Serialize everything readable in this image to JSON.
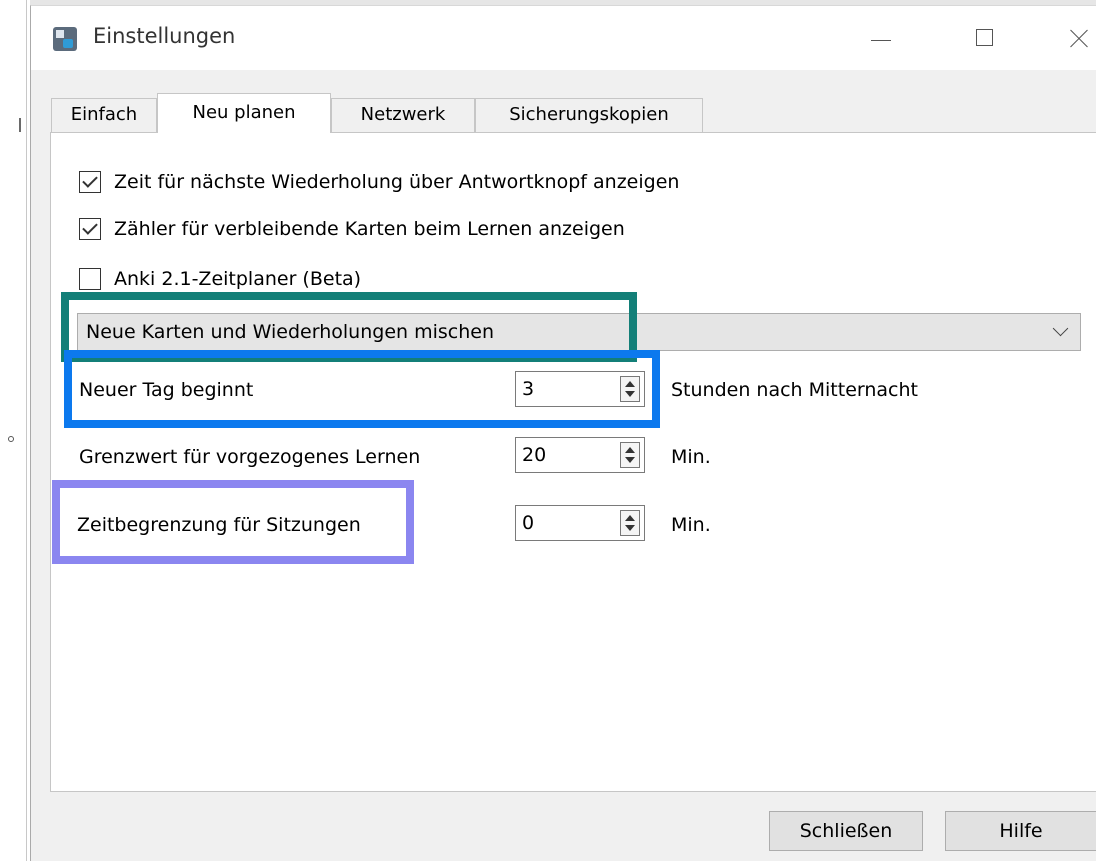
{
  "window": {
    "title": "Einstellungen",
    "icon": "anki-app-icon",
    "controls": [
      "minimize-icon",
      "maximize-icon",
      "close-icon"
    ]
  },
  "tabs": [
    {
      "label": "Einfach",
      "active": false
    },
    {
      "label": "Neu planen",
      "active": true
    },
    {
      "label": "Netzwerk",
      "active": false
    },
    {
      "label": "Sicherungskopien",
      "active": false
    }
  ],
  "options": {
    "show_next_review_time": {
      "label": "Zeit für nächste Wiederholung über Antwortknopf anzeigen",
      "checked": true
    },
    "show_remaining_count": {
      "label": "Zähler für verbleibende Karten beim Lernen anzeigen",
      "checked": true
    },
    "anki21_scheduler": {
      "label": "Anki 2.1-Zeitplaner (Beta)",
      "checked": false
    }
  },
  "mix_mode": {
    "selected": "Neue Karten und Wiederholungen mischen"
  },
  "fields": {
    "next_day": {
      "label": "Neuer Tag beginnt",
      "value": "3",
      "suffix": "Stunden nach Mitternacht"
    },
    "learn_ahead": {
      "label": "Grenzwert für vorgezogenes Lernen",
      "value": "20",
      "suffix": "Min."
    },
    "timebox": {
      "label": "Zeitbegrenzung für Sitzungen",
      "value": "0",
      "suffix": "Min."
    }
  },
  "buttons": {
    "close": "Schließen",
    "help": "Hilfe"
  },
  "colors": {
    "highlight_teal": "#137f78",
    "highlight_blue": "#0c79ee",
    "highlight_purple": "#8b86f0"
  }
}
